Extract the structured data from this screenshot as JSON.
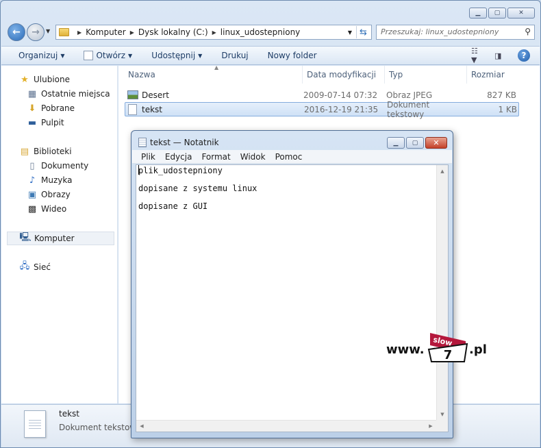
{
  "explorer": {
    "address": {
      "crumbs": [
        "Komputer",
        "Dysk lokalny (C:)",
        "linux_udostepniony"
      ],
      "search_placeholder": "Przeszukaj: linux_udostepniony"
    },
    "toolbar": {
      "organize": "Organizuj",
      "open": "Otwórz",
      "share": "Udostępnij",
      "print": "Drukuj",
      "new_folder": "Nowy folder"
    },
    "nav": {
      "favorites": "Ulubione",
      "recent": "Ostatnie miejsca",
      "downloads": "Pobrane",
      "desktop": "Pulpit",
      "libraries": "Biblioteki",
      "documents": "Dokumenty",
      "music": "Muzyka",
      "pictures": "Obrazy",
      "videos": "Wideo",
      "computer": "Komputer",
      "network": "Sieć"
    },
    "columns": [
      "Nazwa",
      "Data modyfikacji",
      "Typ",
      "Rozmiar"
    ],
    "files": [
      {
        "name": "Desert",
        "date": "2009-07-14 07:32",
        "type": "Obraz JPEG",
        "size": "827 KB",
        "icon": "image-file-icon"
      },
      {
        "name": "tekst",
        "date": "2016-12-19 21:35",
        "type": "Dokument tekstowy",
        "size": "1 KB",
        "icon": "text-file-icon"
      }
    ],
    "details": {
      "name": "tekst",
      "type": "Dokument tekstowy"
    }
  },
  "notepad": {
    "title": "tekst — Notatnik",
    "menu": [
      "Plik",
      "Edycja",
      "Format",
      "Widok",
      "Pomoc"
    ],
    "lines": [
      "plik_udostepniony",
      "dopisane z systemu linux",
      "dopisane z GUI"
    ]
  },
  "watermark": {
    "prefix": "www.",
    "badge_top": "slow",
    "badge_num": "7",
    "suffix": ".pl"
  }
}
